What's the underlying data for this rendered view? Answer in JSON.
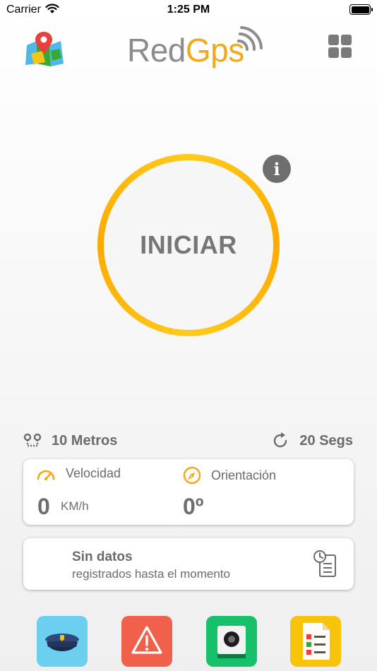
{
  "status_bar": {
    "carrier": "Carrier",
    "time": "1:25 PM"
  },
  "header": {
    "logo_part1": "Red",
    "logo_part2": "Gps"
  },
  "main": {
    "start_label": "INICIAR",
    "ring_colors": [
      "#ffcb1d",
      "#ffa900"
    ]
  },
  "summary": {
    "distance": "10 Metros",
    "interval": "20 Segs"
  },
  "stats": {
    "speed_label": "Velocidad",
    "speed_value": "0",
    "speed_unit": "KM/h",
    "orientation_label": "Orientación",
    "orientation_value": "0º"
  },
  "log": {
    "title": "Sin datos",
    "subtitle": "registrados hasta el momento"
  },
  "colors": {
    "accent": "#f3a81a",
    "police_button": "#6dcff0",
    "alert_button": "#f0604a",
    "camera_button": "#17c06a",
    "report_button": "#f8c40a"
  },
  "icons": {
    "map": "map-pin-icon",
    "grid": "grid-icon",
    "info": "info-icon",
    "distance": "route-icon",
    "interval": "refresh-icon",
    "speed": "speedometer-icon",
    "orientation": "compass-icon",
    "log": "clock-document-icon",
    "bottom": [
      "police-cap-icon",
      "warning-icon",
      "camera-icon",
      "report-icon"
    ]
  }
}
